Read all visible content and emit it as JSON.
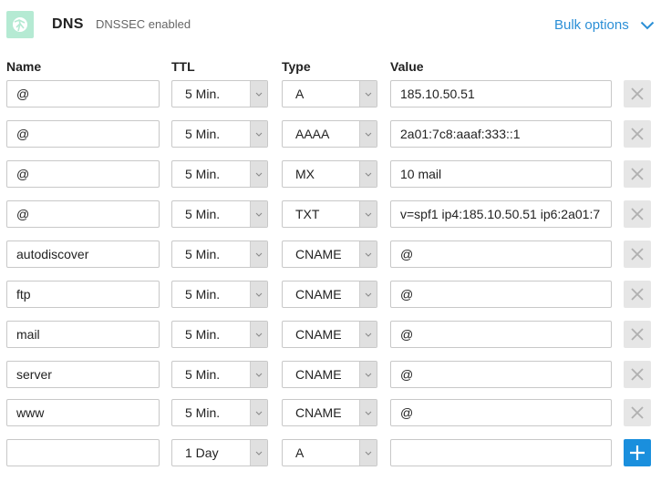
{
  "header": {
    "icon": "globe-icon",
    "title": "DNS",
    "subtitle": "DNSSEC enabled",
    "bulk_label": "Bulk options",
    "accent_color": "#2b8fd6",
    "logo_color": "#b5ead3"
  },
  "columns": {
    "name": "Name",
    "ttl": "TTL",
    "type": "Type",
    "value": "Value"
  },
  "records": [
    {
      "name": "@",
      "ttl": "5 Min.",
      "type": "A",
      "value": "185.10.50.51"
    },
    {
      "name": "@",
      "ttl": "5 Min.",
      "type": "AAAA",
      "value": "2a01:7c8:aaaf:333::1"
    },
    {
      "name": "@",
      "ttl": "5 Min.",
      "type": "MX",
      "value": "10 mail"
    },
    {
      "name": "@",
      "ttl": "5 Min.",
      "type": "TXT",
      "value": "v=spf1 ip4:185.10.50.51 ip6:2a01:7"
    },
    {
      "name": "autodiscover",
      "ttl": "5 Min.",
      "type": "CNAME",
      "value": "@"
    },
    {
      "name": "ftp",
      "ttl": "5 Min.",
      "type": "CNAME",
      "value": "@"
    },
    {
      "name": "mail",
      "ttl": "5 Min.",
      "type": "CNAME",
      "value": "@"
    },
    {
      "name": "server",
      "ttl": "5 Min.",
      "type": "CNAME",
      "value": "@"
    },
    {
      "name": "www",
      "ttl": "5 Min.",
      "type": "CNAME",
      "value": "@"
    }
  ],
  "new_record": {
    "name": "",
    "ttl": "1 Day",
    "type": "A",
    "value": ""
  },
  "add_color": "#1a8fdd"
}
